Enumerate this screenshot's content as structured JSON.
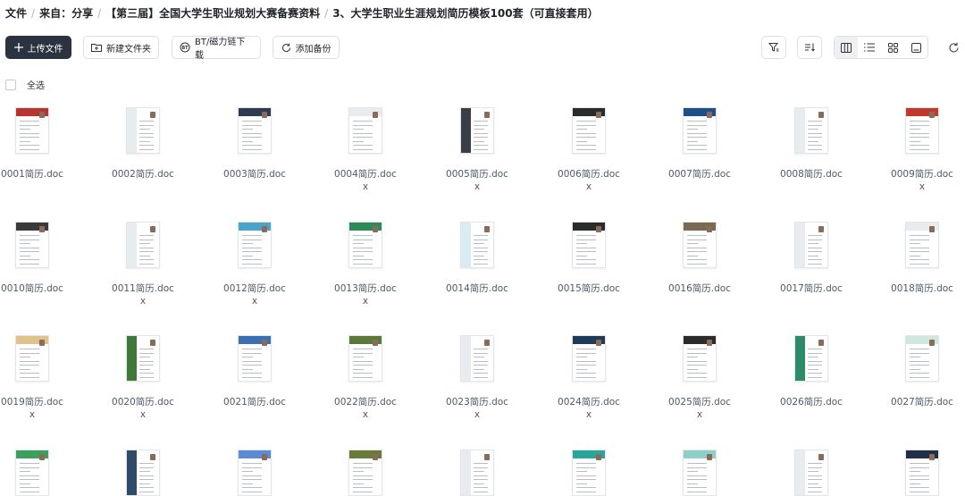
{
  "breadcrumb": [
    "文件",
    "来自：分享",
    "【第三届】全国大学生职业规划大赛备赛资料",
    "3、大学生职业生涯规划简历模板100套（可直接套用）"
  ],
  "toolbar": {
    "upload_label": "上传文件",
    "new_folder_label": "新建文件夹",
    "bt_label": "BT/磁力链下载",
    "add_backup_label": "添加备份"
  },
  "select_all_label": "全选",
  "files": [
    {
      "l1": "0001简历.doc",
      "l2": ""
    },
    {
      "l1": "0002简历.doc",
      "l2": ""
    },
    {
      "l1": "0003简历.doc",
      "l2": ""
    },
    {
      "l1": "0004简历.doc",
      "l2": "x"
    },
    {
      "l1": "0005简历.doc",
      "l2": "x"
    },
    {
      "l1": "0006简历.doc",
      "l2": "x"
    },
    {
      "l1": "0007简历.doc",
      "l2": ""
    },
    {
      "l1": "0008简历.doc",
      "l2": ""
    },
    {
      "l1": "0009简历.doc",
      "l2": "x"
    },
    {
      "l1": "0010简历.doc",
      "l2": ""
    },
    {
      "l1": "0011简历.doc",
      "l2": "x"
    },
    {
      "l1": "0012简历.doc",
      "l2": "x"
    },
    {
      "l1": "0013简历.doc",
      "l2": "x"
    },
    {
      "l1": "0014简历.doc",
      "l2": ""
    },
    {
      "l1": "0015简历.doc",
      "l2": ""
    },
    {
      "l1": "0016简历.doc",
      "l2": ""
    },
    {
      "l1": "0017简历.doc",
      "l2": ""
    },
    {
      "l1": "0018简历.doc",
      "l2": ""
    },
    {
      "l1": "0019简历.doc",
      "l2": "x"
    },
    {
      "l1": "0020简历.doc",
      "l2": "x"
    },
    {
      "l1": "0021简历.doc",
      "l2": ""
    },
    {
      "l1": "0022简历.doc",
      "l2": "x"
    },
    {
      "l1": "0023简历.doc",
      "l2": "x"
    },
    {
      "l1": "0024简历.doc",
      "l2": "x"
    },
    {
      "l1": "0025简历.doc",
      "l2": "x"
    },
    {
      "l1": "0026简历.doc",
      "l2": ""
    },
    {
      "l1": "0027简历.doc",
      "l2": ""
    },
    {
      "l1": "",
      "l2": ""
    },
    {
      "l1": "",
      "l2": ""
    },
    {
      "l1": "",
      "l2": ""
    },
    {
      "l1": "",
      "l2": ""
    },
    {
      "l1": "",
      "l2": ""
    },
    {
      "l1": "",
      "l2": ""
    },
    {
      "l1": "",
      "l2": ""
    },
    {
      "l1": "",
      "l2": ""
    },
    {
      "l1": "",
      "l2": ""
    }
  ],
  "thumb_colors": [
    "#b8342e",
    "#ffffff",
    "#2f3b52",
    "#ffffff",
    "#3a3f47",
    "#2b2b2b",
    "#1f4e8c",
    "#ffffff",
    "#c0392b",
    "#3a3a3a",
    "#ffffff",
    "#4aa3c9",
    "#2e8b57",
    "#d9ecf2",
    "#2b2b2b",
    "#7a6a52",
    "#ffffff",
    "#ffffff",
    "#e0c28a",
    "#3f7a3a",
    "#3a6fb5",
    "#5a7a3a",
    "#ffffff",
    "#1f3b5a",
    "#2b2b2b",
    "#2e8b6a",
    "#cfe8de",
    "#3aa05a",
    "#2f4a6a",
    "#5b8ad6",
    "#6a7a3a",
    "#ffffff",
    "#2aa59a",
    "#8fcfc7",
    "#ffffff",
    "#1f2f4a"
  ],
  "colors": {
    "primary": "#2b3240",
    "text": "#1f2329",
    "muted": "#4e5969",
    "border": "#dcdfe4"
  }
}
